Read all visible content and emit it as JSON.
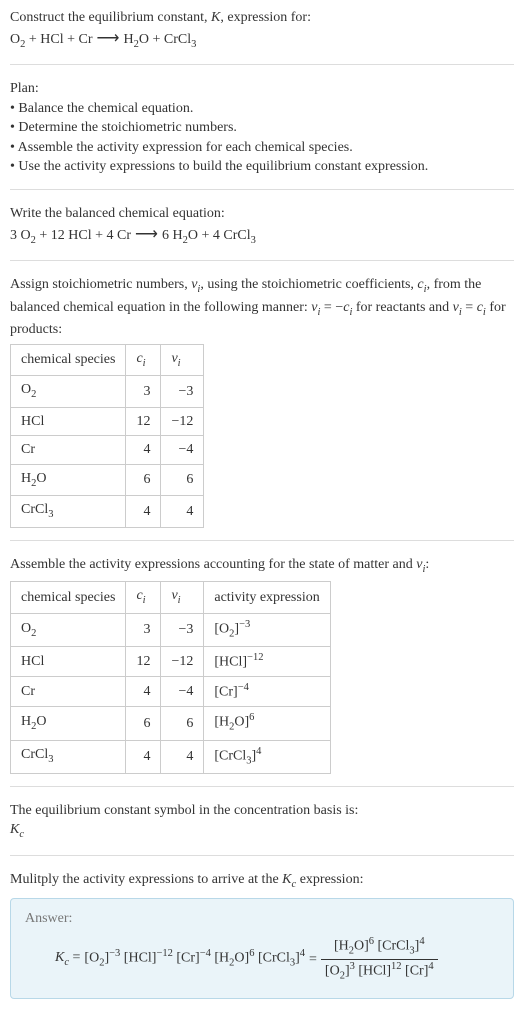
{
  "intro": {
    "line1": "Construct the equilibrium constant, ",
    "K": "K",
    "line1b": ", expression for:",
    "eq_lhs_O2": "O",
    "eq_lhs_O2s": "2",
    "plus": " + ",
    "eq_lhs_HCl": "HCl",
    "eq_lhs_Cr": "Cr",
    "arrow": " ⟶ ",
    "eq_rhs_H2O_H": "H",
    "eq_rhs_H2O_2": "2",
    "eq_rhs_H2O_O": "O",
    "eq_rhs_CrCl3_CrCl": "CrCl",
    "eq_rhs_CrCl3_3": "3"
  },
  "plan": {
    "heading": "Plan:",
    "b1": "• Balance the chemical equation.",
    "b2": "• Determine the stoichiometric numbers.",
    "b3": "• Assemble the activity expression for each chemical species.",
    "b4": "• Use the activity expressions to build the equilibrium constant expression."
  },
  "balanced": {
    "heading": "Write the balanced chemical equation:",
    "c_O2": "3 ",
    "O": "O",
    "two": "2",
    "c_HCl": "12 ",
    "HCl": "HCl",
    "c_Cr": "4 ",
    "Cr": "Cr",
    "arrow": " ⟶ ",
    "c_H2O": " 6 ",
    "H": "H",
    "Ow": "O",
    "c_CrCl3": "4 ",
    "CrCl": "CrCl",
    "three": "3",
    "plus": " + "
  },
  "stoich": {
    "text1": "Assign stoichiometric numbers, ",
    "nu": "ν",
    "i": "i",
    "text2": ", using the stoichiometric coefficients, ",
    "c": "c",
    "text3": ", from the balanced chemical equation in the following manner: ",
    "eq1a": "ν",
    "eq1b": "i",
    "eq1c": " = −",
    "eq1d": "c",
    "eq1e": "i",
    "text4": " for reactants and ",
    "eq2a": "ν",
    "eq2b": "i",
    "eq2c": " = ",
    "eq2d": "c",
    "eq2e": "i",
    "text5": " for products:",
    "th_species": "chemical species",
    "th_ci_c": "c",
    "th_ci_i": "i",
    "th_nui_n": "ν",
    "th_nui_i": "i",
    "rows": [
      {
        "sp_a": "O",
        "sp_b": "2",
        "ci": "3",
        "nui": "−3"
      },
      {
        "sp_a": "HCl",
        "sp_b": "",
        "ci": "12",
        "nui": "−12"
      },
      {
        "sp_a": "Cr",
        "sp_b": "",
        "ci": "4",
        "nui": "−4"
      },
      {
        "sp_a": "H",
        "sp_b": "2",
        "sp_c": "O",
        "ci": "6",
        "nui": "6"
      },
      {
        "sp_a": "CrCl",
        "sp_b": "3",
        "ci": "4",
        "nui": "4"
      }
    ]
  },
  "activity": {
    "heading": "Assemble the activity expressions accounting for the state of matter and ",
    "nu": "ν",
    "i": "i",
    "colon": ":",
    "th_species": "chemical species",
    "th_ci_c": "c",
    "th_ci_i": "i",
    "th_nui_n": "ν",
    "th_nui_i": "i",
    "th_act": "activity expression",
    "rows": [
      {
        "sp_a": "O",
        "sp_b": "2",
        "ci": "3",
        "nui": "−3",
        "act_l": "[O",
        "act_s": "2",
        "act_r": "]",
        "act_e": "−3"
      },
      {
        "sp_a": "HCl",
        "sp_b": "",
        "ci": "12",
        "nui": "−12",
        "act_l": "[HCl",
        "act_s": "",
        "act_r": "]",
        "act_e": "−12"
      },
      {
        "sp_a": "Cr",
        "sp_b": "",
        "ci": "4",
        "nui": "−4",
        "act_l": "[Cr",
        "act_s": "",
        "act_r": "]",
        "act_e": "−4"
      },
      {
        "sp_a": "H",
        "sp_b": "2",
        "sp_c": "O",
        "ci": "6",
        "nui": "6",
        "act_l": "[H",
        "act_s": "2",
        "act_r": "O]",
        "act_e": "6"
      },
      {
        "sp_a": "CrCl",
        "sp_b": "3",
        "ci": "4",
        "nui": "4",
        "act_l": "[CrCl",
        "act_s": "3",
        "act_r": "]",
        "act_e": "4"
      }
    ]
  },
  "symbol": {
    "text": "The equilibrium constant symbol in the concentration basis is:",
    "K": "K",
    "c": "c"
  },
  "final": {
    "heading": "Mulitply the activity expressions to arrive at the ",
    "K": "K",
    "c": "c",
    "heading2": " expression:",
    "answer": "Answer:",
    "Kc_K": "K",
    "Kc_c": "c",
    "eq": " = ",
    "t1_l": "[O",
    "t1_s": "2",
    "t1_r": "]",
    "t1_e": "−3",
    "t2_l": " [HCl]",
    "t2_e": "−12",
    "t3_l": " [Cr]",
    "t3_e": "−4",
    "t4_l": " [H",
    "t4_s": "2",
    "t4_r": "O]",
    "t4_e": "6",
    "t5_l": " [CrCl",
    "t5_s": "3",
    "t5_r": "]",
    "t5_e": "4",
    "eq2": " = ",
    "num_a_l": "[H",
    "num_a_s": "2",
    "num_a_r": "O]",
    "num_a_e": "6",
    "num_b_l": " [CrCl",
    "num_b_s": "3",
    "num_b_r": "]",
    "num_b_e": "4",
    "den_a_l": "[O",
    "den_a_s": "2",
    "den_a_r": "]",
    "den_a_e": "3",
    "den_b_l": " [HCl]",
    "den_b_e": "12",
    "den_c_l": " [Cr]",
    "den_c_e": "4"
  }
}
